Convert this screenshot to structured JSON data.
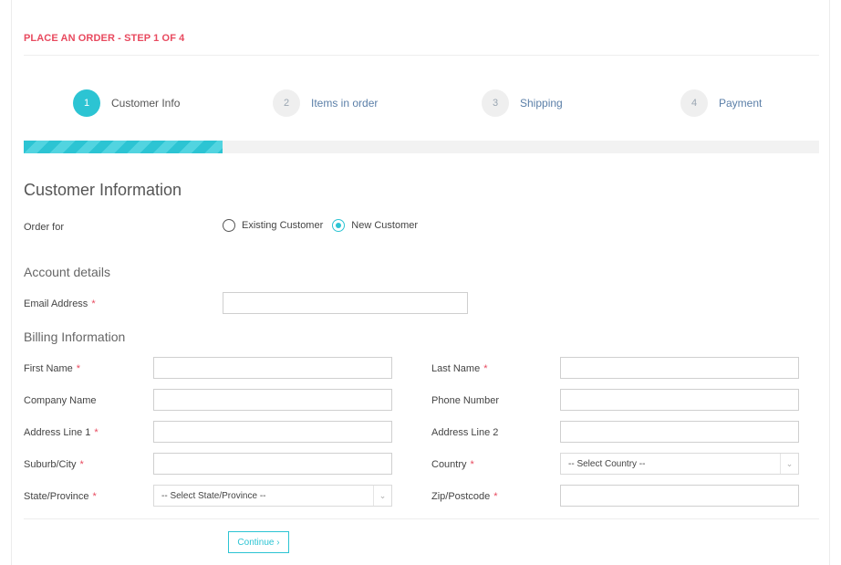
{
  "header": {
    "title": "PLACE AN ORDER - STEP 1 OF 4"
  },
  "steps": [
    {
      "number": "1",
      "label": "Customer Info",
      "active": true
    },
    {
      "number": "2",
      "label": "Items in order",
      "active": false
    },
    {
      "number": "3",
      "label": "Shipping",
      "active": false
    },
    {
      "number": "4",
      "label": "Payment",
      "active": false
    }
  ],
  "progress": {
    "fraction": 0.25
  },
  "customer_section": {
    "title": "Customer Information",
    "order_for_label": "Order for",
    "options": [
      {
        "label": "Existing Customer",
        "checked": false
      },
      {
        "label": "New Customer",
        "checked": true
      }
    ]
  },
  "account": {
    "title": "Account details",
    "email_label": "Email Address",
    "email_value": ""
  },
  "billing": {
    "title": "Billing Information",
    "first_name": "First Name",
    "last_name": "Last Name",
    "company": "Company Name",
    "phone": "Phone Number",
    "address1": "Address Line 1",
    "address2": "Address Line 2",
    "city": "Suburb/City",
    "country": "Country",
    "country_selected": "-- Select Country --",
    "state": "State/Province",
    "state_selected": "-- Select State/Province --",
    "zip": "Zip/Postcode",
    "required_mark": "*"
  },
  "actions": {
    "continue_label": "Continue ›"
  },
  "colors": {
    "accent": "#2cc4d3",
    "header_red": "#e84a5f",
    "step_link": "#5b7fa8"
  }
}
